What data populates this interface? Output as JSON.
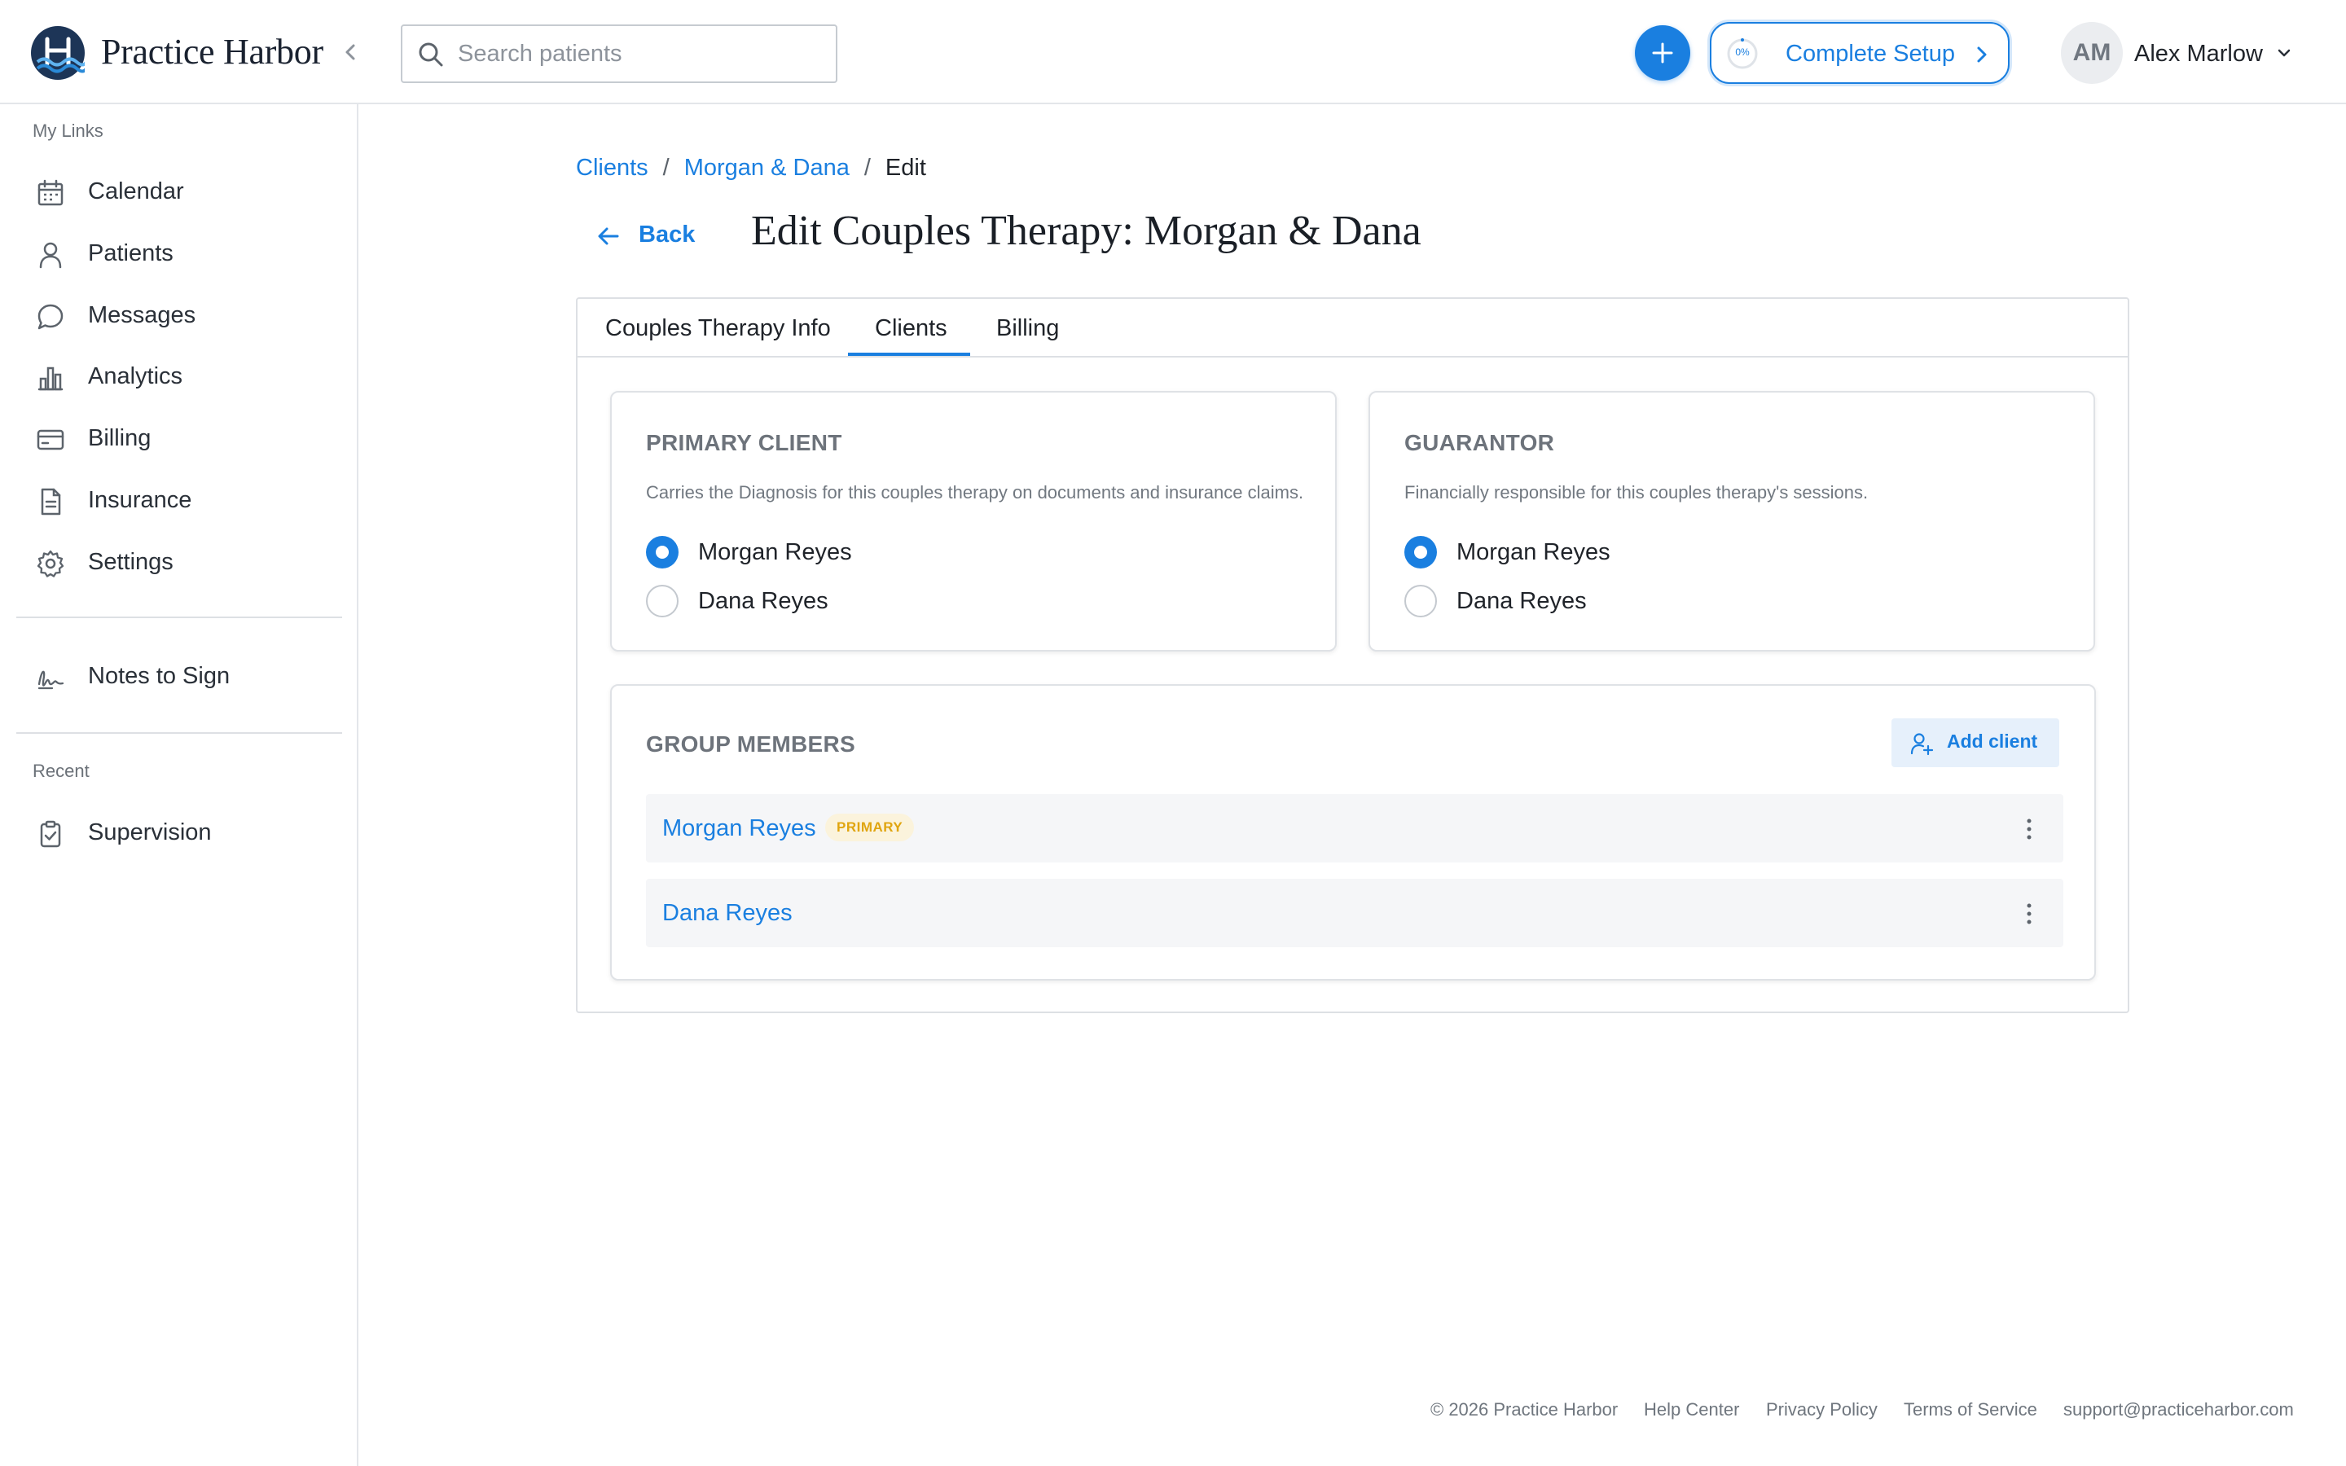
{
  "app": {
    "brand": "Practice Harbor"
  },
  "header": {
    "search_placeholder": "Search patients",
    "setup": {
      "label": "Complete Setup",
      "progress_label": "0%",
      "progress": 0
    },
    "user": {
      "initials": "AM",
      "name": "Alex Marlow"
    }
  },
  "sidebar": {
    "section_links": "My Links",
    "items": [
      {
        "label": "Calendar",
        "icon": "calendar-icon"
      },
      {
        "label": "Patients",
        "icon": "person-icon"
      },
      {
        "label": "Messages",
        "icon": "chat-bubble-icon"
      },
      {
        "label": "Analytics",
        "icon": "bar-chart-icon"
      },
      {
        "label": "Billing",
        "icon": "credit-card-icon"
      },
      {
        "label": "Insurance",
        "icon": "document-icon"
      },
      {
        "label": "Settings",
        "icon": "gear-icon"
      }
    ],
    "notes": {
      "label": "Notes to Sign",
      "icon": "signature-icon"
    },
    "section_recent": "Recent",
    "recent": [
      {
        "label": "Supervision",
        "icon": "clipboard-check-icon"
      }
    ]
  },
  "breadcrumb": {
    "items": [
      "Clients",
      "Morgan & Dana"
    ],
    "separator": "/",
    "current": "Edit"
  },
  "page": {
    "back_label": "Back",
    "title": "Edit Couples Therapy: Morgan & Dana"
  },
  "tabs": {
    "items": [
      "Couples Therapy Info",
      "Clients",
      "Billing"
    ],
    "active": "Clients"
  },
  "primary_client": {
    "title": "PRIMARY CLIENT",
    "description": "Carries the Diagnosis for this couples therapy on documents and insurance claims.",
    "options": [
      "Morgan Reyes",
      "Dana Reyes"
    ],
    "selected": "Morgan Reyes"
  },
  "guarantor": {
    "title": "GUARANTOR",
    "description": "Financially responsible for this couples therapy's sessions.",
    "options": [
      "Morgan Reyes",
      "Dana Reyes"
    ],
    "selected": "Morgan Reyes"
  },
  "group_members": {
    "title": "GROUP MEMBERS",
    "add_label": "Add client",
    "members": [
      {
        "name": "Morgan Reyes",
        "badge": "PRIMARY"
      },
      {
        "name": "Dana Reyes",
        "badge": ""
      }
    ]
  },
  "footer": {
    "copyright": "© 2026 Practice Harbor",
    "links": [
      "Help Center",
      "Privacy Policy",
      "Terms of Service"
    ],
    "email": "support@practiceharbor.com"
  },
  "colors": {
    "accent": "#1a7fe0",
    "badge_bg": "#fbf3dc",
    "badge_text": "#e0a510",
    "muted_text": "#6d737b"
  }
}
